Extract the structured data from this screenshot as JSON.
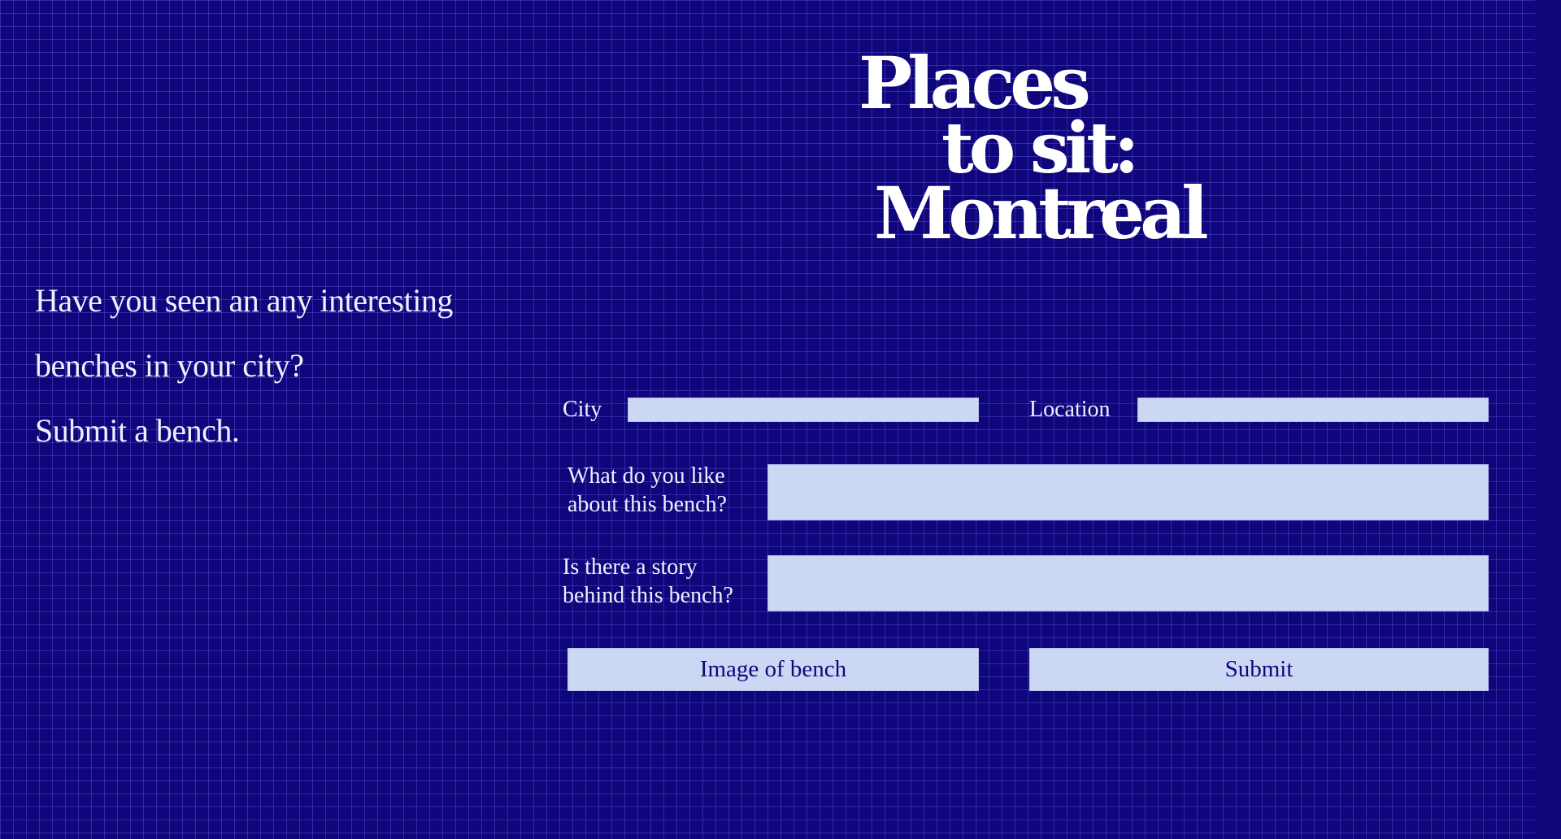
{
  "title": {
    "line1": "Places",
    "line2": "to sit:",
    "line3": "Montreal"
  },
  "intro": {
    "line1": "Have you seen an any interesting",
    "line2": "benches in your city?",
    "line3": "Submit a bench."
  },
  "form": {
    "city_label": "City",
    "city_value": "",
    "location_label": "Location",
    "location_value": "",
    "like_label_line1": "What do you like",
    "like_label_line2": "about this bench?",
    "like_value": "",
    "story_label_line1": "Is there a story",
    "story_label_line2": "behind this bench?",
    "story_value": "",
    "image_button": "Image of bench",
    "submit_button": "Submit"
  }
}
